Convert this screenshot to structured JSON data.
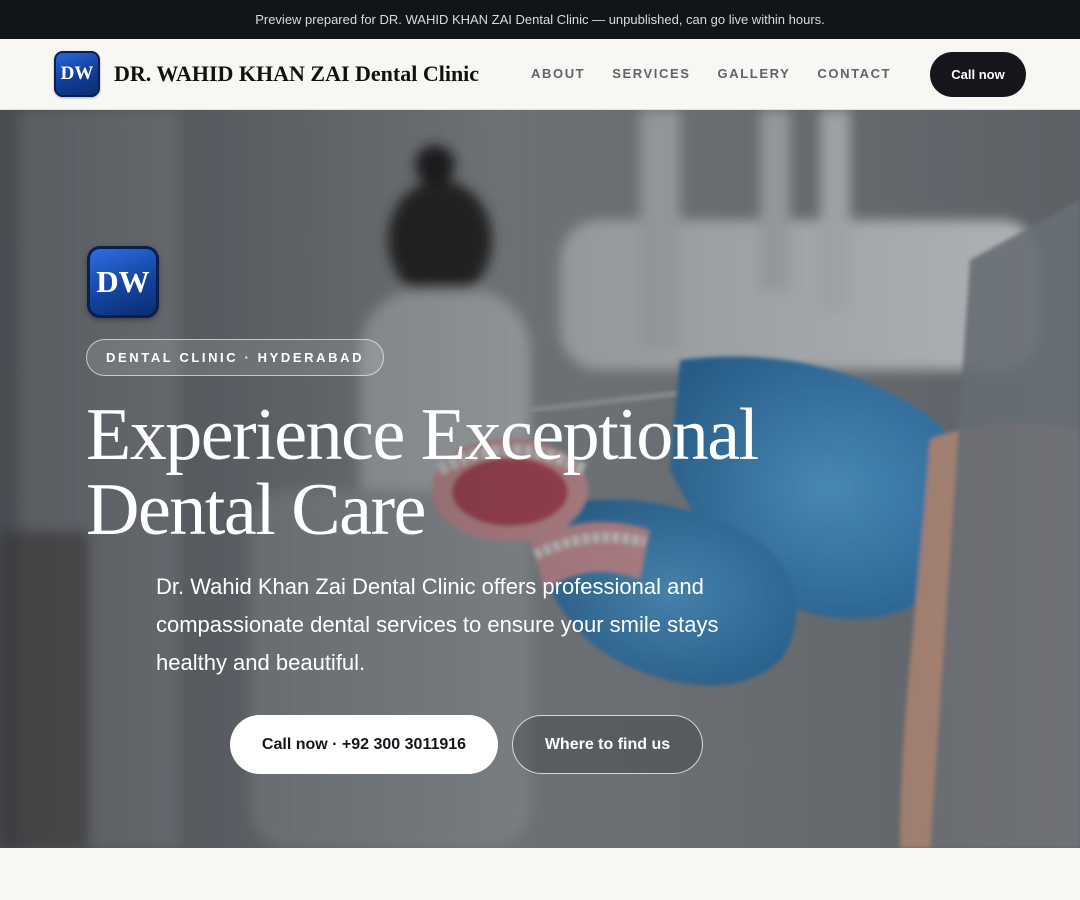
{
  "topbar": {
    "text": "Preview prepared for DR. WAHID KHAN ZAI Dental Clinic — unpublished, can go live within hours."
  },
  "nav": {
    "logo_text": "DW",
    "brand": "DR. WAHID KHAN ZAI Dental Clinic",
    "links": [
      "ABOUT",
      "SERVICES",
      "GALLERY",
      "CONTACT"
    ],
    "cta": "Call now"
  },
  "hero": {
    "logo_text": "DW",
    "eyebrow": "DENTAL CLINIC · HYDERABAD",
    "headline_line1": "Experience Exceptional",
    "headline_line2": "Dental Care",
    "subtext": "Dr. Wahid Khan Zai Dental Clinic offers professional and compassionate dental services to ensure your smile stays healthy and beautiful.",
    "primary_cta": "Call now · +92 300 3011916",
    "secondary_cta": "Where to find us"
  },
  "colors": {
    "topbar_bg": "#111419",
    "page_bg": "#f8f7f4",
    "brand_blue": "#14449f",
    "dark_button": "#14161b",
    "glove_blue": "#4a9bd6"
  }
}
